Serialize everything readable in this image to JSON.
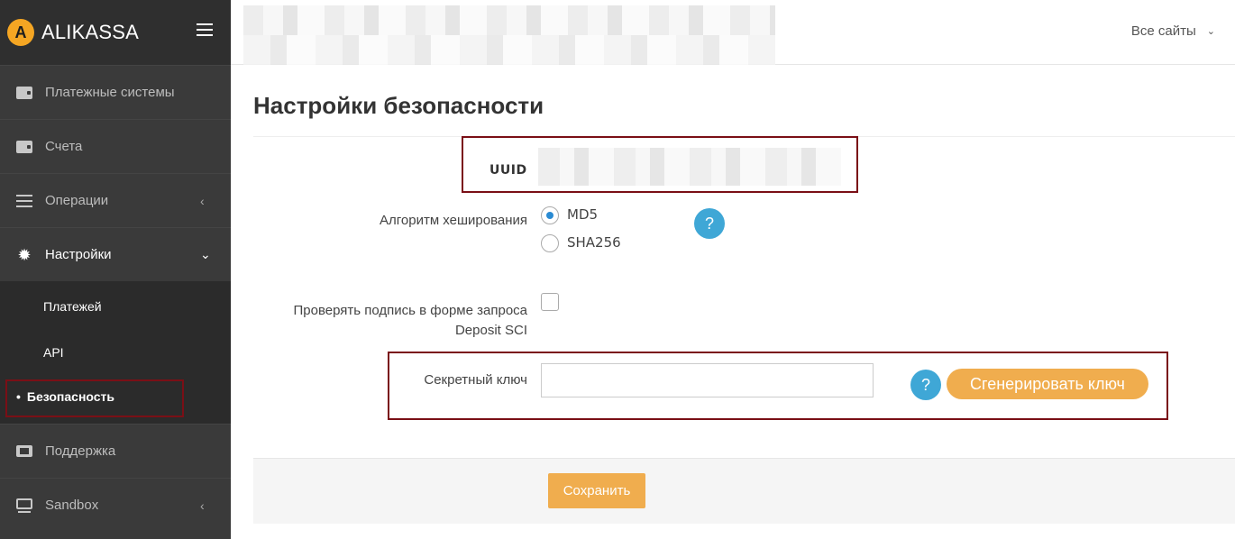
{
  "brand": {
    "logo_letter": "A",
    "name": "ALIKASSA"
  },
  "sidebar": {
    "items": [
      {
        "label": "Платежные системы",
        "icon": "wallet-icon"
      },
      {
        "label": "Счета",
        "icon": "wallet-icon"
      },
      {
        "label": "Операции",
        "icon": "list-icon",
        "chevron": "‹"
      },
      {
        "label": "Настройки",
        "icon": "gear-icon",
        "chevron": "⌄"
      },
      {
        "label": "Поддержка",
        "icon": "ticket-icon"
      },
      {
        "label": "Sandbox",
        "icon": "monitor-icon",
        "chevron": "‹"
      }
    ],
    "submenu": [
      "Платежей",
      "API",
      "Безопасность"
    ]
  },
  "header": {
    "sites_label": "Все сайты",
    "chevron": "⌄"
  },
  "page": {
    "title": "Настройки безопасности",
    "uuid_label": "UUID",
    "hash_label": "Алгоритм хеширования",
    "hash_options": [
      "MD5",
      "SHA256"
    ],
    "hash_selected": "MD5",
    "help_glyph": "?",
    "verify_label_line1": "Проверять подпись в форме запроса",
    "verify_label_line2": "Deposit SCI",
    "secret_label": "Секретный ключ",
    "secret_value": "",
    "generate_label": "Сгенерировать ключ",
    "save_label": "Сохранить"
  },
  "colors": {
    "accent": "#f0ad4e",
    "help": "#3fa7d6",
    "sidebar": "#3a3a3a",
    "highlight": "#7a0f16",
    "radio_checked": "#2a8bd3"
  }
}
